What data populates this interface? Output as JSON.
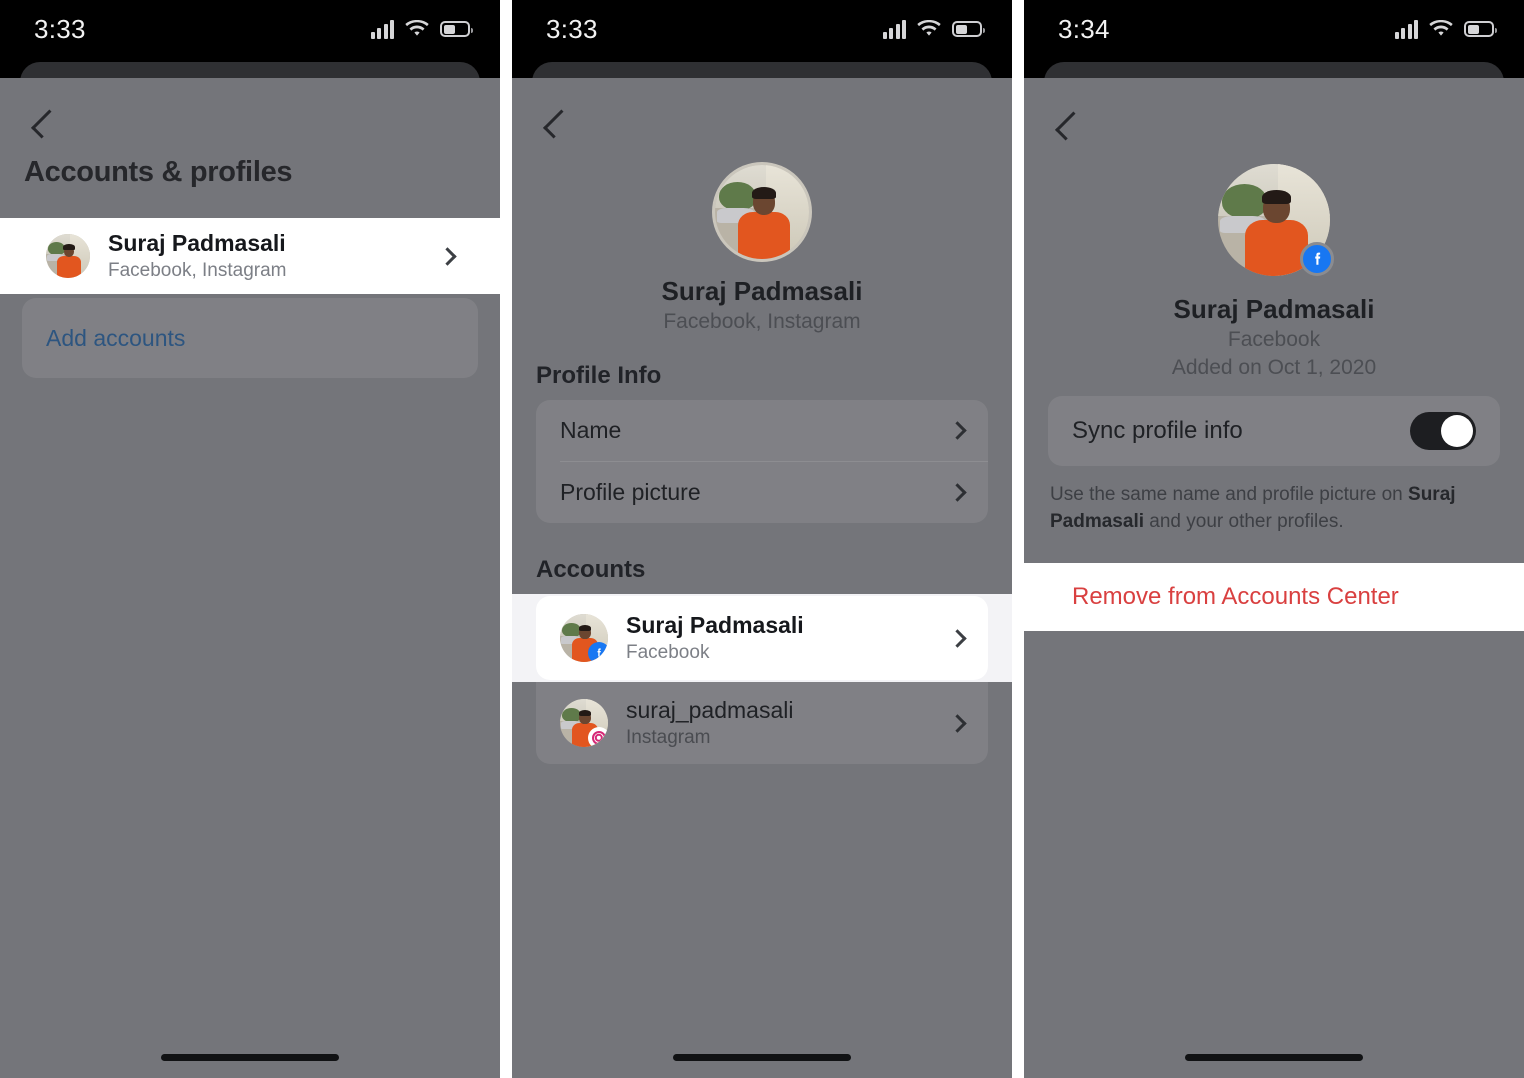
{
  "screens": [
    {
      "status": {
        "time": "3:33",
        "cellular": "signal-bars-icon",
        "wifi": "wifi-icon",
        "battery": "battery-icon",
        "battery_level": 45
      },
      "nav": {
        "back": "back-chevron-icon"
      },
      "title": "Accounts & profiles",
      "profile_row": {
        "name": "Suraj Padmasali",
        "subtitle": "Facebook, Instagram",
        "chevron": "chevron-right-icon",
        "highlighted": true
      },
      "add_accounts_label": "Add accounts"
    },
    {
      "status": {
        "time": "3:33",
        "cellular": "signal-bars-icon",
        "wifi": "wifi-icon",
        "battery": "battery-icon",
        "battery_level": 45
      },
      "nav": {
        "back": "back-chevron-icon"
      },
      "header": {
        "name": "Suraj Padmasali",
        "subtitle": "Facebook, Instagram",
        "avatar": "profile-avatar"
      },
      "profile_info": {
        "section_label": "Profile Info",
        "items": [
          {
            "label": "Name",
            "chevron": "chevron-right-icon"
          },
          {
            "label": "Profile picture",
            "chevron": "chevron-right-icon"
          }
        ]
      },
      "accounts": {
        "section_label": "Accounts",
        "items": [
          {
            "name": "Suraj Padmasali",
            "platform": "Facebook",
            "badge": "facebook-badge-icon",
            "chevron": "chevron-right-icon",
            "highlighted": true
          },
          {
            "name": "suraj_padmasali",
            "platform": "Instagram",
            "badge": "instagram-badge-icon",
            "chevron": "chevron-right-icon",
            "highlighted": false
          }
        ]
      }
    },
    {
      "status": {
        "time": "3:34",
        "cellular": "signal-bars-icon",
        "wifi": "wifi-icon",
        "battery": "battery-icon",
        "battery_level": 45
      },
      "nav": {
        "back": "back-chevron-icon"
      },
      "header": {
        "name": "Suraj Padmasali",
        "platform": "Facebook",
        "added_on": "Added on Oct 1, 2020",
        "avatar": "profile-avatar",
        "badge": "facebook-badge-icon"
      },
      "sync": {
        "label": "Sync profile info",
        "enabled": true,
        "helper_prefix": "Use the same name and profile picture on ",
        "helper_bold": "Suraj Padmasali",
        "helper_suffix": " and your other profiles."
      },
      "remove_label": "Remove from Accounts Center"
    }
  ],
  "colors": {
    "sheet_gray": "#74757a",
    "accent_blue": "#2d5580",
    "danger_red": "#d94040",
    "facebook_blue": "#1877f2",
    "instagram_pink": "#d62976",
    "white": "#ffffff",
    "status_black": "#000000"
  }
}
